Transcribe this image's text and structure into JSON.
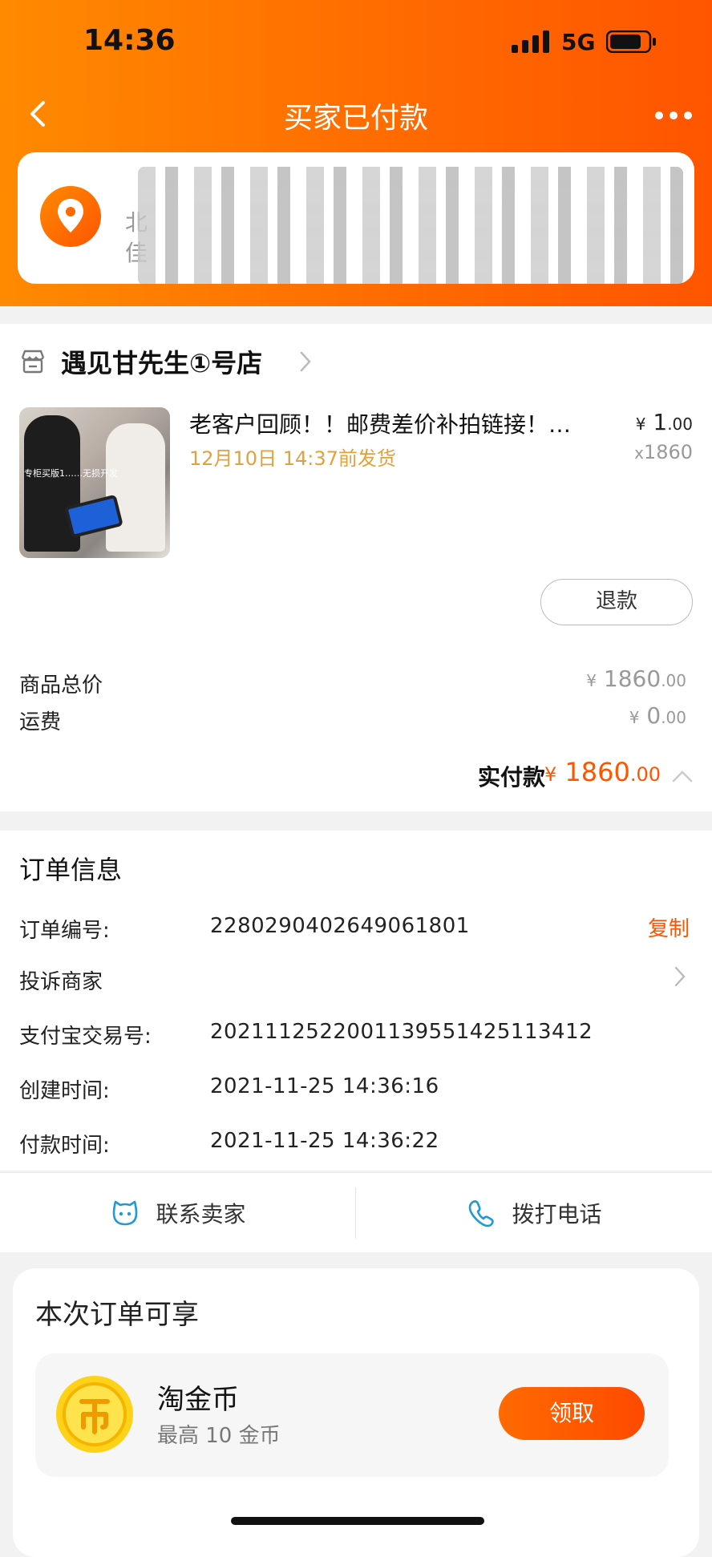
{
  "status_bar": {
    "time": "14:36",
    "network": "5G"
  },
  "nav": {
    "title": "买家已付款"
  },
  "address": {
    "name": "",
    "line1": "北",
    "line2": "佳"
  },
  "shop": {
    "name": "遇见甘先生①号店"
  },
  "item": {
    "title": "老客户回顾！！邮费差价补拍链接！…",
    "ship_note": "12月10日 14:37前发货",
    "price_currency": "¥",
    "price_int": "1",
    "price_dec": ".00",
    "qty_prefix": "x",
    "qty": "1860",
    "thumb_caption": "专柜买版1……无损开发",
    "refund_label": "退款"
  },
  "totals": {
    "goods_label": "商品总价",
    "goods_currency": "¥",
    "goods_int": "1860",
    "goods_dec": ".00",
    "shipping_label": "运费",
    "shipping_currency": "¥",
    "shipping_int": "0",
    "shipping_dec": ".00",
    "paid_label": "实付款",
    "paid_currency": "¥",
    "paid_int": "1860",
    "paid_dec": ".00"
  },
  "order": {
    "section_title": "订单信息",
    "number_label": "订单编号:",
    "number": "2280290402649061801",
    "copy_label": "复制",
    "complain_label": "投诉商家",
    "alipay_label": "支付宝交易号:",
    "alipay_no": "2021112522001139551425113412",
    "created_label": "创建时间:",
    "created": "2021-11-25 14:36:16",
    "paid_label": "付款时间:",
    "paid": "2021-11-25 14:36:22"
  },
  "contact": {
    "seller_label": "联系卖家",
    "call_label": "拨打电话"
  },
  "bonus": {
    "title": "本次订单可享",
    "coin_name": "淘金币",
    "coin_sub": "最高 10 金币",
    "claim_label": "领取"
  },
  "colors": {
    "accent": "#ff5500",
    "header_start": "#ff8a00",
    "header_end": "#ff5500",
    "ship_note": "#e3a03b",
    "contact_icon": "#1e9bd7"
  },
  "icons": [
    "back-arrow",
    "more-dots",
    "location-pin",
    "shop",
    "chevron-right",
    "chevron-up",
    "chat-bubble",
    "phone",
    "gold-coin",
    "signal",
    "battery"
  ]
}
